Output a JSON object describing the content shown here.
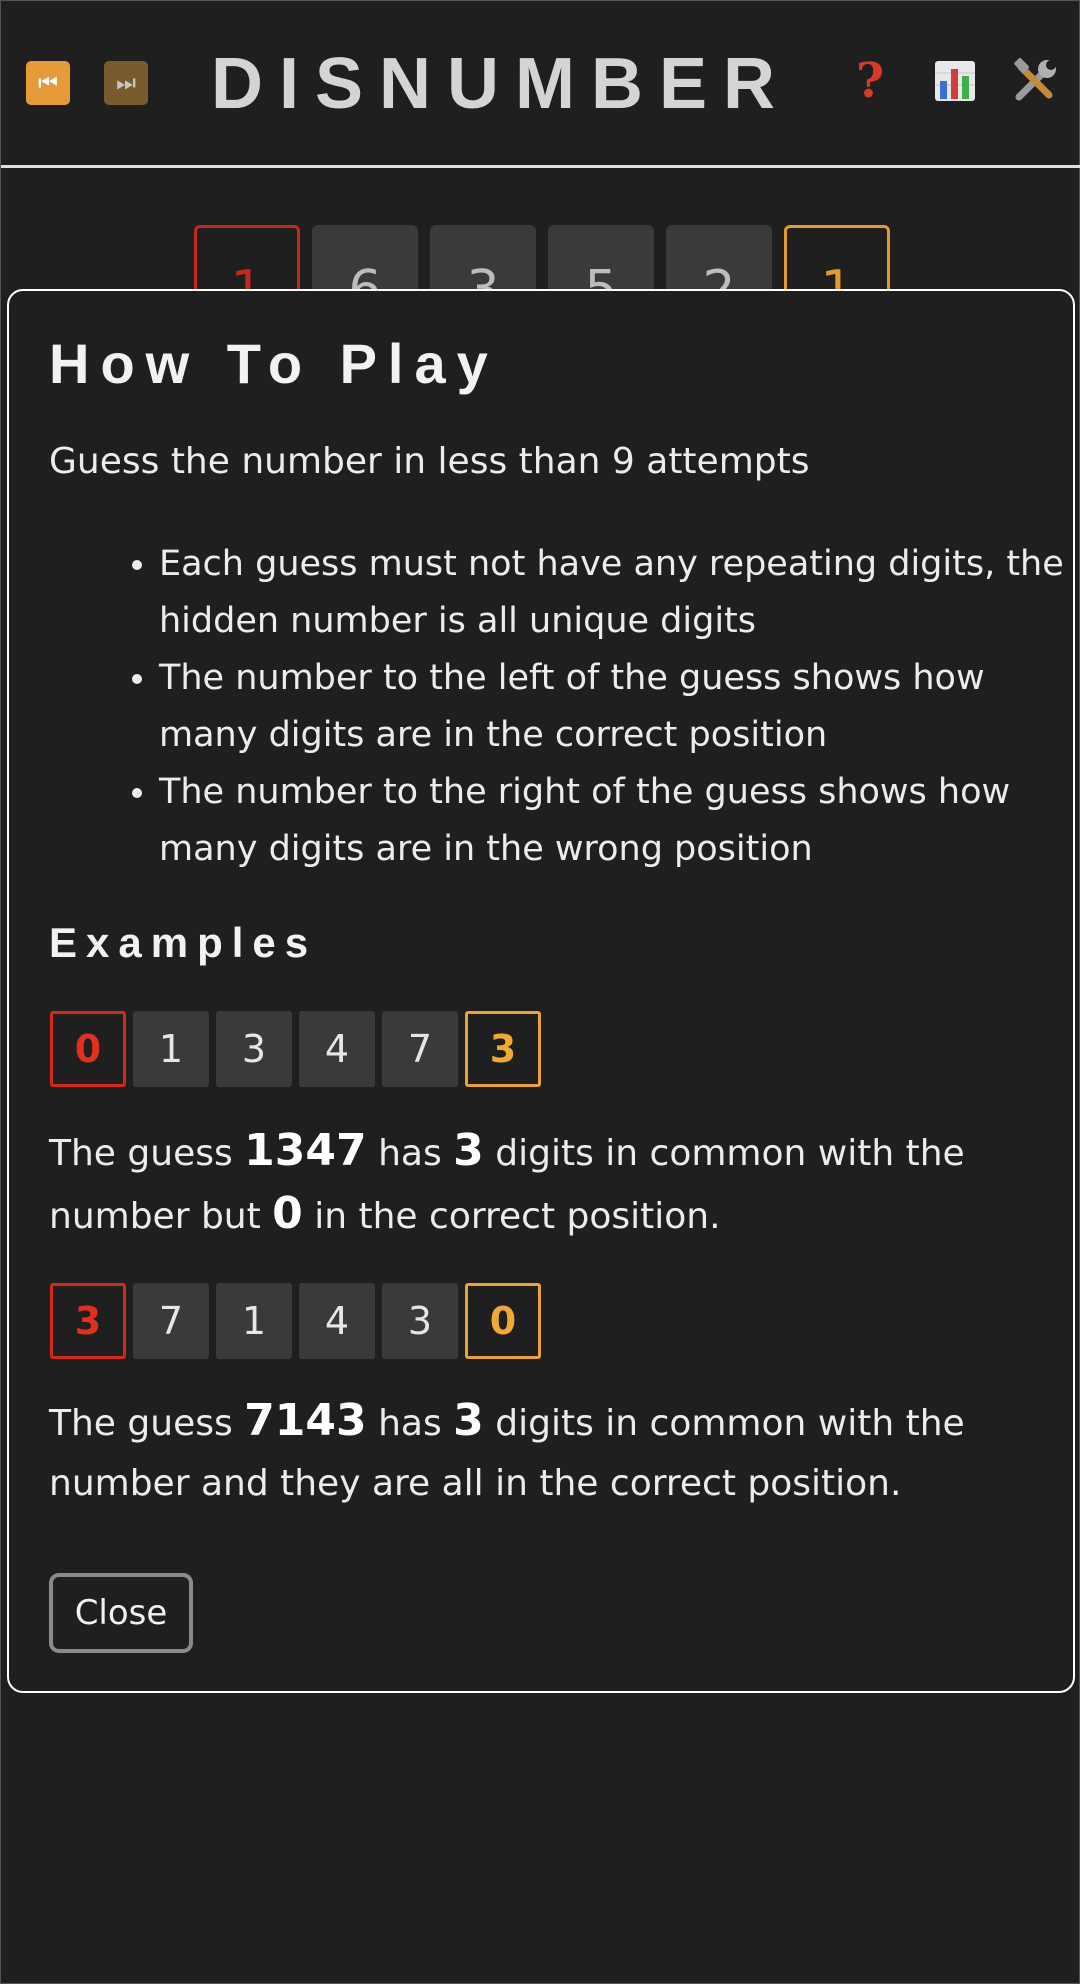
{
  "header": {
    "title": "DISNUMBER",
    "prev_icon": "⏮",
    "next_icon": "⏭",
    "help_icon": "?",
    "stats_icon": "bar-chart-icon",
    "tools_icon": "tools-icon"
  },
  "board": {
    "correct_count": "1",
    "digits": [
      "6",
      "3",
      "5",
      "2"
    ],
    "wrong_count": "1"
  },
  "modal": {
    "title": "How To Play",
    "intro": "Guess the number in less than 9 attempts",
    "rules": [
      "Each guess must not have any repeating digits, the hidden number is all unique digits",
      "The number to the left of the guess shows how many digits are in the correct position",
      "The number to the right of the guess shows how many digits are in the wrong position"
    ],
    "examples_title": "Examples",
    "examples": [
      {
        "correct": "0",
        "digits": [
          "1",
          "3",
          "4",
          "7"
        ],
        "wrong": "3",
        "text_1": "The guess ",
        "guess": "1347",
        "text_2": " has ",
        "common": "3",
        "text_3": " digits in common with the number but ",
        "in_position": "0",
        "text_4": " in the correct position."
      },
      {
        "correct": "3",
        "digits": [
          "7",
          "1",
          "4",
          "3"
        ],
        "wrong": "0",
        "text_1": "The guess ",
        "guess": "7143",
        "text_2": " has ",
        "common": "3",
        "text_3": " digits in common with the number and they are all in the correct position."
      }
    ],
    "close_label": "Close"
  },
  "colors": {
    "background": "#1f1f1f",
    "correct_red": "#d3291c",
    "wrong_orange": "#e9a336",
    "tile_gray": "#3a3a3a"
  }
}
